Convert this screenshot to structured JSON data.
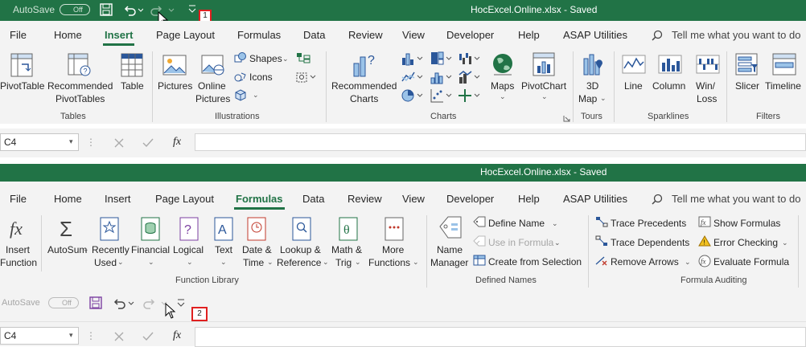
{
  "top": {
    "autosave_label": "AutoSave",
    "autosave_state": "Off",
    "title": "HocExcel.Online.xlsx - Saved",
    "callout": "1",
    "tabs": [
      "File",
      "Home",
      "Insert",
      "Page Layout",
      "Formulas",
      "Data",
      "Review",
      "View",
      "Developer",
      "Help",
      "ASAP Utilities"
    ],
    "active_tab": "Insert",
    "tellme": "Tell me what you want to do",
    "buttons": {
      "pivottable": "PivotTable",
      "rec_pivot_1": "Recommended",
      "rec_pivot_2": "PivotTables",
      "table": "Table",
      "pictures": "Pictures",
      "online_1": "Online",
      "online_2": "Pictures",
      "shapes": "Shapes",
      "icons": "Icons",
      "rec_charts_1": "Recommended",
      "rec_charts_2": "Charts",
      "maps": "Maps",
      "pivotchart": "PivotChart",
      "map3d_1": "3D",
      "map3d_2": "Map",
      "line": "Line",
      "column": "Column",
      "winloss_1": "Win/",
      "winloss_2": "Loss",
      "slicer": "Slicer",
      "timeline": "Timeline"
    },
    "groups": [
      "Tables",
      "Illustrations",
      "Charts",
      "Tours",
      "Sparklines",
      "Filters"
    ],
    "namebox": "C4",
    "fx": "fx"
  },
  "bottom": {
    "title": "HocExcel.Online.xlsx - Saved",
    "tabs": [
      "File",
      "Home",
      "Insert",
      "Page Layout",
      "Formulas",
      "Data",
      "Review",
      "View",
      "Developer",
      "Help",
      "ASAP Utilities"
    ],
    "active_tab": "Formulas",
    "tellme": "Tell me what you want to do",
    "buttons": {
      "insert_fn_1": "Insert",
      "insert_fn_2": "Function",
      "autosum": "AutoSum",
      "recently_1": "Recently",
      "recently_2": "Used",
      "financial": "Financial",
      "logical": "Logical",
      "text": "Text",
      "datetime_1": "Date &",
      "datetime_2": "Time",
      "lookup_1": "Lookup &",
      "lookup_2": "Reference",
      "mathtrig_1": "Math &",
      "mathtrig_2": "Trig",
      "more_1": "More",
      "more_2": "Functions",
      "name_mgr_1": "Name",
      "name_mgr_2": "Manager",
      "define_name": "Define Name",
      "use_in_formula": "Use in Formula",
      "create_from_sel": "Create from Selection",
      "trace_precedents": "Trace Precedents",
      "trace_dependents": "Trace Dependents",
      "remove_arrows": "Remove Arrows",
      "show_formulas": "Show Formulas",
      "error_checking": "Error Checking",
      "evaluate_formula": "Evaluate Formula"
    },
    "groups": [
      "Function Library",
      "Defined Names",
      "Formula Auditing"
    ],
    "qat_autosave_label": "AutoSave",
    "qat_autosave_state": "Off",
    "callout": "2",
    "namebox": "C4",
    "fx": "fx"
  },
  "colors": {
    "excel_green": "#217346",
    "ribbon_bg": "#f3f3f3",
    "callout_red": "#e02020",
    "icon_blue": "#2b579a",
    "icon_green": "#217346",
    "icon_purple": "#7b3fa0",
    "icon_red": "#c0392b"
  }
}
